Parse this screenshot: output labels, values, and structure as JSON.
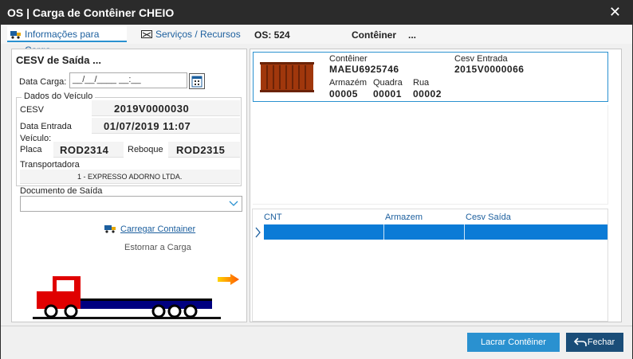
{
  "window": {
    "title": "OS | Carga de Contêiner CHEIO",
    "close_glyph": "✕"
  },
  "tabs": [
    {
      "label": "Informações para Carga"
    },
    {
      "label": "Serviços / Recursos"
    }
  ],
  "header": {
    "os_label": "OS: 524",
    "container_label": "Contêiner",
    "container_value": "..."
  },
  "left": {
    "title": "CESV de Saída ...",
    "data_carga_label": "Data Carga:",
    "data_carga_value": "__/__/____ __:__",
    "dados_veiculo_label": "Dados do Veículo",
    "cesv_label": "CESV",
    "cesv_value": "2019V0000030",
    "data_entrada_label": "Data Entrada",
    "data_entrada_value": "01/07/2019 11:07",
    "veiculo_label": "Veículo:",
    "placa_label": "Placa",
    "placa_value": "ROD2314",
    "reboque_label": "Reboque",
    "reboque_value": "ROD2315",
    "transportadora_label": "Transportadora",
    "transportadora_value": "1 - EXPRESSO ADORNO LTDA.",
    "documento_label": "Documento de Saída",
    "carregar_label": "Carregar Container",
    "estornar_label": "Estornar a Carga"
  },
  "container_card": {
    "conteiner_label": "Contêiner",
    "conteiner_value": "MAEU6925746",
    "cesv_entrada_label": "Cesv Entrada",
    "cesv_entrada_value": "2015V0000066",
    "armazem_label": "Armazém",
    "armazem_value": "00005",
    "quadra_label": "Quadra",
    "quadra_value": "00001",
    "rua_label": "Rua",
    "rua_value": "00002"
  },
  "grid": {
    "columns": [
      "CNT",
      "Armazem",
      "Cesv Saída"
    ]
  },
  "footer": {
    "lacrar_label": "Lacrar Contêiner",
    "fechar_label": "Fechar"
  },
  "colors": {
    "accent": "#2a91d0",
    "selected_row": "#0b7bd6",
    "titlebar": "#2b2b2b",
    "truck_red": "#e00000",
    "trailer_blue": "#000080"
  }
}
